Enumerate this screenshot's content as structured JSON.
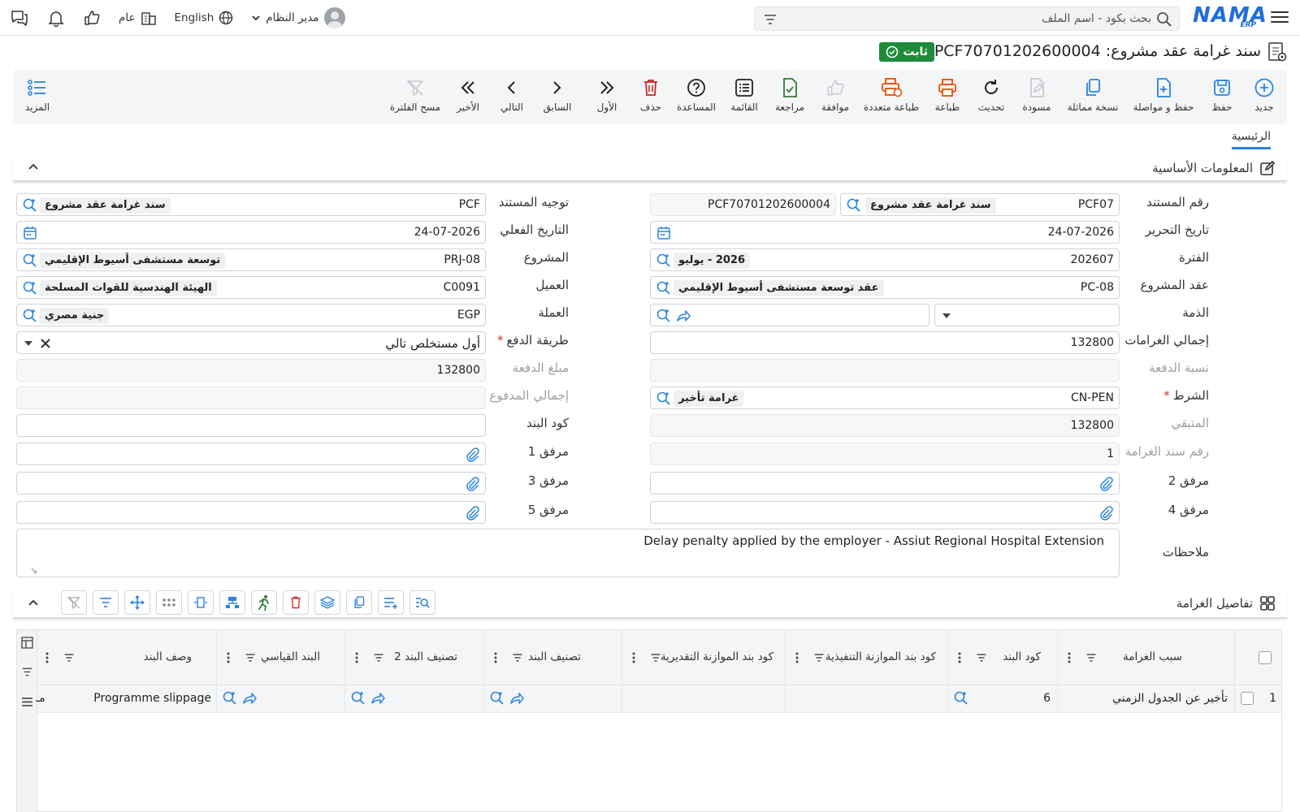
{
  "topbar": {
    "search_placeholder": "بحث بكود - اسم الملف",
    "logo": "NAMA",
    "logo_sub": "ERP",
    "user": "مدير النظام",
    "language": "English",
    "scope": "عام"
  },
  "page": {
    "title": "سند غرامة عقد مشروع: PCF70701202600004",
    "status": "ثابت"
  },
  "toolbar": {
    "new": "جديد",
    "save": "حفظ",
    "save_continue": "حفظ و مواصلة",
    "duplicate": "نسخة مماثلة",
    "draft": "مسودة",
    "refresh": "تحديث",
    "print": "طباعة",
    "multi_print": "طباعة متعددة",
    "approve": "موافقة",
    "review": "مراجعة",
    "list": "القائمة",
    "help": "المساعدة",
    "delete": "حذف",
    "first": "الأول",
    "previous": "السابق",
    "next": "التالي",
    "last": "الأخير",
    "clear_filter": "مسح الفلترة",
    "more": "المزيد"
  },
  "tabs": {
    "main": "الرئيسية"
  },
  "basic_section": {
    "title": "المعلومات الأساسية"
  },
  "form": {
    "doc_number": {
      "label": "رقم المستند",
      "code": "PCF07",
      "desc": "سند غرامة عقد مشروع",
      "number": "PCF70701202600004"
    },
    "doc_direction": {
      "label": "توجيه المستند",
      "code": "PCF",
      "desc": "سند غرامة عقد مشروع"
    },
    "issue_date": {
      "label": "تاريخ التحرير",
      "value": "24-07-2026"
    },
    "actual_date": {
      "label": "التاريخ الفعلي",
      "value": "24-07-2026"
    },
    "period": {
      "label": "الفترة",
      "code": "202607",
      "desc": "2026 - يوليو"
    },
    "project": {
      "label": "المشروع",
      "code": "PRJ-08",
      "desc": "توسعة مستشفى أسيوط الإقليمي"
    },
    "project_contract": {
      "label": "عقد المشروع",
      "code": "PC-08",
      "desc": "عقد توسعة مستشفى أسيوط الإقليمي"
    },
    "customer": {
      "label": "العميل",
      "code": "C0091",
      "desc": "الهيئة الهندسية للقوات المسلحة"
    },
    "liability": {
      "label": "الذمة",
      "value": ""
    },
    "currency": {
      "label": "العملة",
      "code": "EGP",
      "desc": "جنية مصري"
    },
    "total_penalties": {
      "label": "إجمالي الغرامات",
      "value": "132800"
    },
    "payment_method": {
      "label": "طريقة الدفع",
      "value": "أول مستخلص تالي"
    },
    "payment_ratio": {
      "label": "نسبة الدفعة",
      "value": ""
    },
    "payment_amount": {
      "label": "مبلغ الدفعة",
      "value": "132800"
    },
    "condition": {
      "label": "الشرط",
      "code": "CN-PEN",
      "desc": "غرامة تأخير"
    },
    "total_paid": {
      "label": "إجمالي المدفوع",
      "value": ""
    },
    "remaining": {
      "label": "المتبقي",
      "value": "132800"
    },
    "item_code": {
      "label": "كود البند",
      "value": ""
    },
    "penalty_doc_no": {
      "label": "رقم سند الغرامة",
      "value": "1"
    },
    "attachment1": {
      "label": "مرفق 1"
    },
    "attachment2": {
      "label": "مرفق 2"
    },
    "attachment3": {
      "label": "مرفق 3"
    },
    "attachment4": {
      "label": "مرفق 4"
    },
    "attachment5": {
      "label": "مرفق 5"
    },
    "notes": {
      "label": "ملاحظات",
      "value": "Delay penalty applied by the employer - Assiut Regional Hospital Extension"
    }
  },
  "details_section": {
    "title": "تفاصيل الغرامة"
  },
  "grid": {
    "columns": [
      "سبب الغرامة",
      "كود البند",
      "كود بند الموازنة التنفيذية",
      "كود بند الموازنة التقديرية",
      "تصنيف البند",
      "تصنيف البند 2",
      "البند القياسي",
      "وصف البند"
    ],
    "rows": [
      {
        "index": "1",
        "reason": "تأخير عن الجدول الزمني",
        "item_code": "6",
        "exec_budget": "",
        "est_budget": "",
        "category": "",
        "category2": "",
        "standard_item": "",
        "description": "Programme slippage",
        "overflow": "مـ"
      }
    ]
  },
  "colors": {
    "accent": "#2a84e0",
    "success": "#1f8b3a",
    "danger": "#d32f2f"
  }
}
